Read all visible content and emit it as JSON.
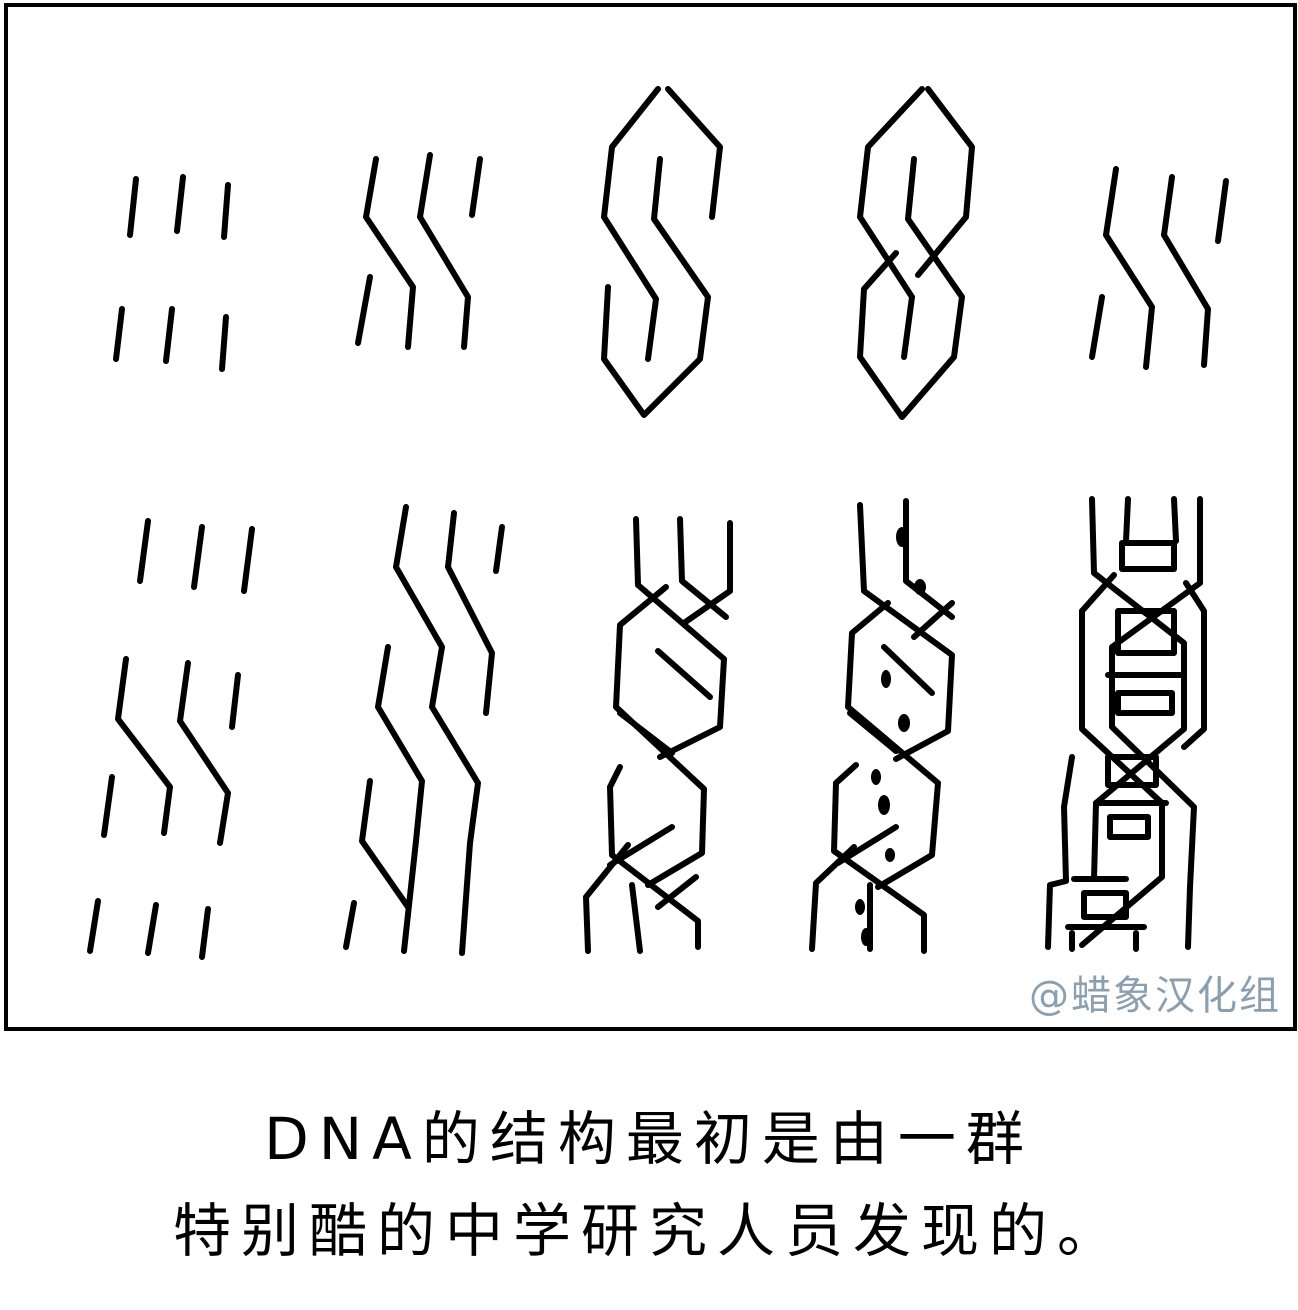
{
  "watermark": "@蜡象汉化组",
  "caption": {
    "line1": "DNA的结构最初是由一群",
    "line2": "特别酷的中学研究人员发现的。"
  }
}
